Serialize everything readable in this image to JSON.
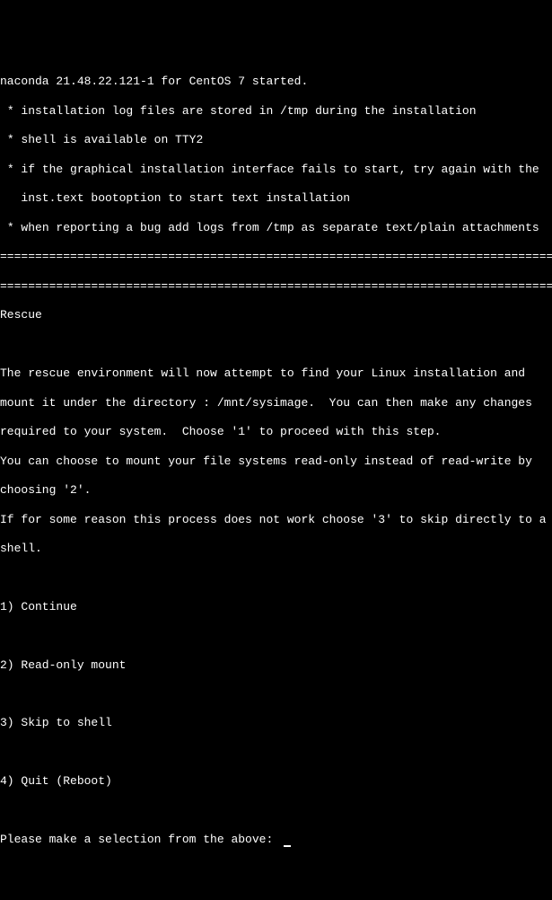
{
  "header": {
    "start_line": "naconda 21.48.22.121-1 for CentOS 7 started.",
    "bullets": [
      " * installation log files are stored in /tmp during the installation",
      " * shell is available on TTY2",
      " * if the graphical installation interface fails to start, try again with the",
      "   inst.text bootoption to start text installation",
      " * when reporting a bug add logs from /tmp as separate text/plain attachments"
    ],
    "divider1": "================================================================================",
    "divider2": "================================================================================"
  },
  "rescue": {
    "title": "Rescue",
    "para1": "The rescue environment will now attempt to find your Linux installation and",
    "para2": "mount it under the directory : /mnt/sysimage.  You can then make any changes",
    "para3": "required to your system.  Choose '1' to proceed with this step.",
    "para4": "You can choose to mount your file systems read-only instead of read-write by",
    "para5": "choosing '2'.",
    "para6": "If for some reason this process does not work choose '3' to skip directly to a",
    "para7": "shell."
  },
  "options": {
    "opt1": "1) Continue",
    "opt2": "2) Read-only mount",
    "opt3": "3) Skip to shell",
    "opt4": "4) Quit (Reboot)"
  },
  "prompt": {
    "text": "Please make a selection from the above: "
  }
}
